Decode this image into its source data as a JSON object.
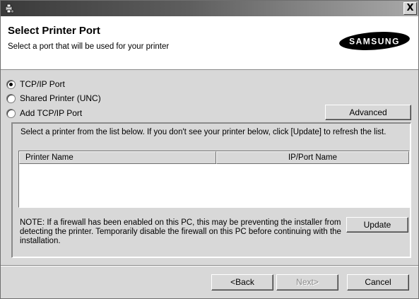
{
  "window": {
    "icon": "installer-icon",
    "close_label": "X"
  },
  "header": {
    "title": "Select Printer Port",
    "subtitle": "Select a port that will be used for your printer",
    "logo_text": "SAMSUNG",
    "logo_color": "#000000"
  },
  "port_options": [
    {
      "label": "TCP/IP Port",
      "selected": true
    },
    {
      "label": "Shared Printer (UNC)",
      "selected": false
    },
    {
      "label": "Add TCP/IP Port",
      "selected": false
    }
  ],
  "advanced_label": "Advanced",
  "printer_list": {
    "instruction": "Select a printer from the list below. If you don't see your printer below, click [Update] to refresh the list.",
    "columns": [
      "Printer Name",
      "IP/Port Name"
    ],
    "rows": []
  },
  "note": "NOTE: If a firewall has been enabled on this PC, this may be preventing the installer from detecting the printer. Temporarily disable the firewall on this PC before continuing with the installation.",
  "update_label": "Update",
  "footer": {
    "back_label": "<Back",
    "next_label": "Next>",
    "cancel_label": "Cancel"
  }
}
